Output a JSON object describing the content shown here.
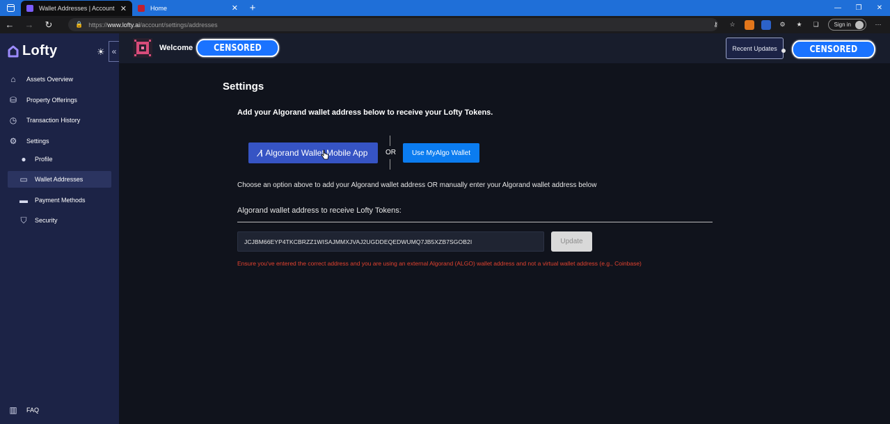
{
  "browser": {
    "tabs": [
      {
        "title": "Wallet Addresses | Account Setti",
        "close": "✕",
        "active": true,
        "favicon_color": "#7b5cff"
      },
      {
        "title": "Home",
        "close": "✕",
        "active": false,
        "favicon_color": "#c0202f"
      }
    ],
    "new_tab": "+",
    "window_controls": [
      "—",
      "❐",
      "✕"
    ],
    "url_scheme": "https://",
    "url_host": "www.lofty.ai",
    "url_path": "/account/settings/addresses",
    "sign_in": "Sign in",
    "accent": "#1f6fd8"
  },
  "sidebar": {
    "brand": "Lofty",
    "items": [
      {
        "label": "Assets Overview",
        "icon": "home-icon"
      },
      {
        "label": "Property Offerings",
        "icon": "coins-icon"
      },
      {
        "label": "Transaction History",
        "icon": "clock-icon"
      },
      {
        "label": "Settings",
        "icon": "gears-icon"
      },
      {
        "label": "Profile",
        "icon": "user-icon"
      },
      {
        "label": "Wallet Addresses",
        "icon": "wallet-icon",
        "active": true
      },
      {
        "label": "Payment Methods",
        "icon": "credit-card-icon"
      },
      {
        "label": "Security",
        "icon": "shield-icon"
      },
      {
        "label": "FAQ",
        "icon": "book-icon"
      }
    ]
  },
  "header": {
    "welcome": "Welcome",
    "censored_name": "CENSORED",
    "recent_updates": "Recent Updates",
    "censored_account": "CENSORED"
  },
  "main": {
    "title": "Settings",
    "lead": "Add your Algorand wallet address below to receive your Lofty Tokens.",
    "algorand_button": "Algorand Wallet Mobile App",
    "or": "OR",
    "myalgo_button": "Use MyAlgo Wallet",
    "hint": "Choose an option above to add your Algorand wallet address OR manually enter your Algorand wallet address below",
    "field_label": "Algorand wallet address to receive Lofty Tokens:",
    "address_value": "JCJBM66EYP4TKCBRZZ1WISAJMMXJVAJ2UGDDEQEDWUMQ7JB5XZB7SGOB2I",
    "update_button": "Update",
    "warning": "Ensure you've entered the correct address and you are using an external Algorand (ALGO) wallet address and not a virtual wallet address (e.g., Coinbase)"
  }
}
